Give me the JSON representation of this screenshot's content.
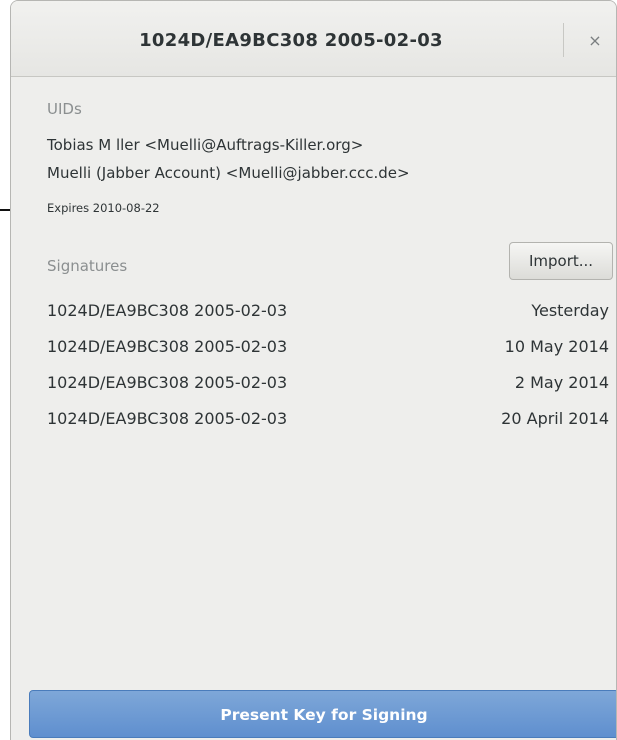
{
  "window": {
    "title": "1024D/EA9BC308 2005-02-03",
    "close_label": "×"
  },
  "uids": {
    "label": "UIDs",
    "items": [
      "Tobias M ller <Muelli@Auftrags-Killer.org>",
      "Muelli (Jabber Account) <Muelli@jabber.ccc.de>"
    ],
    "expires": "Expires 2010-08-22"
  },
  "signatures": {
    "label": "Signatures",
    "import_label": "Import...",
    "rows": [
      {
        "key": "1024D/EA9BC308 2005-02-03",
        "date": "Yesterday"
      },
      {
        "key": "1024D/EA9BC308 2005-02-03",
        "date": "10 May 2014"
      },
      {
        "key": "1024D/EA9BC308 2005-02-03",
        "date": "2 May 2014"
      },
      {
        "key": "1024D/EA9BC308 2005-02-03",
        "date": "20 April 2014"
      }
    ]
  },
  "actions": {
    "present_label": "Present Key for Signing"
  },
  "colors": {
    "background": "#eeeeec",
    "accent": "#6a99d3",
    "text": "#2e3436",
    "muted": "#8b8f90"
  }
}
